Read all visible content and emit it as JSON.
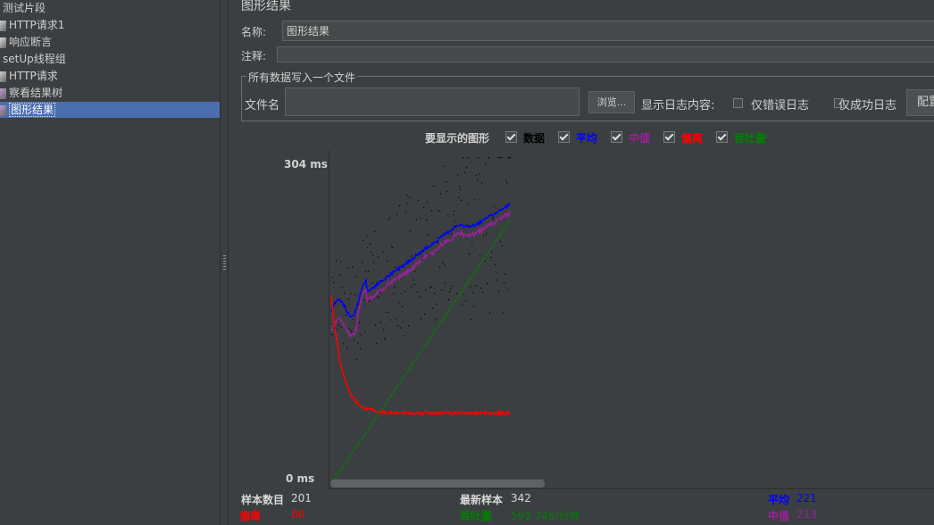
{
  "tree": {
    "items": [
      {
        "label": "测试片段",
        "icon": "test-fragment-icon",
        "indent": 0
      },
      {
        "label": "HTTP请求1",
        "icon": "sampler-icon",
        "indent": 1
      },
      {
        "label": "响应断言",
        "icon": "assertion-icon",
        "indent": 1
      },
      {
        "label": "setUp线程组",
        "icon": "thread-group-icon",
        "indent": 0
      },
      {
        "label": "HTTP请求",
        "icon": "sampler-icon",
        "indent": 1
      },
      {
        "label": "察看结果树",
        "icon": "listener-icon",
        "indent": 1
      },
      {
        "label": "图形结果",
        "icon": "listener-icon",
        "indent": 1,
        "selected": true
      }
    ]
  },
  "panel": {
    "title": "图形结果",
    "name_label": "名称:",
    "name_value": "图形结果",
    "comment_label": "注释:",
    "comment_value": "",
    "fieldset_legend": "所有数据写入一个文件",
    "filename_label": "文件名",
    "filename_value": "",
    "browse_button": "浏览...",
    "log_display_label": "显示日志内容:",
    "errors_only_label": "仅错误日志",
    "success_only_label": "仅成功日志",
    "config_button": "配置"
  },
  "graphs_to_display": {
    "label": "要显示的图形",
    "options": [
      {
        "label": "数据",
        "checked": true,
        "color": "#000000"
      },
      {
        "label": "平均",
        "checked": true,
        "color": "#0000ff"
      },
      {
        "label": "中值",
        "checked": true,
        "color": "#9b209b"
      },
      {
        "label": "偏离",
        "checked": true,
        "color": "#ff0000"
      },
      {
        "label": "吞吐量",
        "checked": true,
        "color": "#008000"
      }
    ]
  },
  "chart_data": {
    "type": "line",
    "y_max_label": "304",
    "y_min_label": "0",
    "y_unit": "ms",
    "ylim": [
      0,
      304
    ],
    "x": [
      1,
      201
    ],
    "series": [
      {
        "name": "平均",
        "color": "#0000ff"
      },
      {
        "name": "中值",
        "color": "#9b209b"
      },
      {
        "name": "偏离",
        "color": "#ff0000"
      },
      {
        "name": "吞吐量",
        "color": "#008000"
      },
      {
        "name": "数据",
        "color": "#000000"
      }
    ]
  },
  "stats": {
    "sample_count_label": "样本数目",
    "sample_count_value": "201",
    "latest_sample_label": "最新样本",
    "latest_sample_value": "342",
    "average_label": "平均",
    "average_value": "221",
    "deviation_label": "偏离",
    "deviation_value": "66",
    "throughput_label": "吞吐量",
    "throughput_value": "592.746/分钟",
    "median_label": "中值",
    "median_value": "213"
  }
}
